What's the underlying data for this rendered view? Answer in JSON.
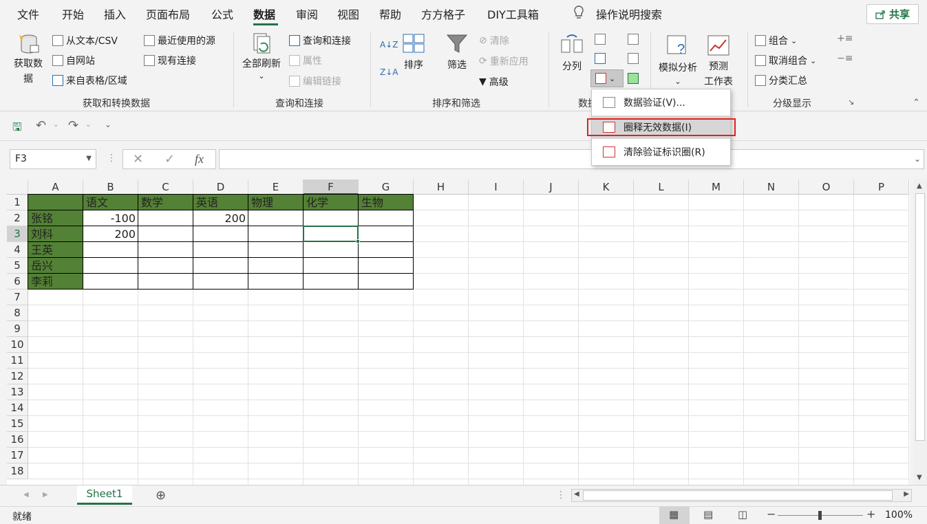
{
  "ribbon_tabs": [
    "文件",
    "开始",
    "插入",
    "页面布局",
    "公式",
    "数据",
    "审阅",
    "视图",
    "帮助",
    "方方格子",
    "DIY工具箱"
  ],
  "active_tab": "数据",
  "search_label": "操作说明搜索",
  "share_label": "共享",
  "groups": {
    "get_transform": {
      "label": "获取和转换数据",
      "get_data_1": "获取数",
      "get_data_2": "据",
      "from_text": "从文本/CSV",
      "from_web": "自网站",
      "from_table": "来自表格/区域",
      "recent_sources": "最近使用的源",
      "existing_conn": "现有连接"
    },
    "queries": {
      "label": "查询和连接",
      "refresh_all": "全部刷新",
      "queries_conn": "查询和连接",
      "properties": "属性",
      "edit_links": "编辑链接"
    },
    "sort_filter": {
      "label": "排序和筛选",
      "sort": "排序",
      "filter": "筛选",
      "clear": "清除",
      "reapply": "重新应用",
      "advanced": "高级"
    },
    "data_tools": {
      "label": "数据",
      "text_to_columns": "分列"
    },
    "forecast": {
      "what_if": "模拟分析",
      "forecast_sheet_1": "预测",
      "forecast_sheet_2": "工作表"
    },
    "outline": {
      "label": "分级显示",
      "group": "组合",
      "ungroup": "取消组合",
      "subtotal": "分类汇总"
    }
  },
  "dropdown": {
    "items": [
      "数据验证(V)...",
      "圈释无效数据(I)",
      "清除验证标识圈(R)"
    ],
    "highlighted_index": 1
  },
  "namebox_value": "F3",
  "formula_value": "",
  "columns": [
    "A",
    "B",
    "C",
    "D",
    "E",
    "F",
    "G",
    "H",
    "I",
    "J",
    "K",
    "L",
    "M",
    "N",
    "O",
    "P"
  ],
  "rows": [
    "1",
    "2",
    "3",
    "4",
    "5",
    "6",
    "7",
    "8",
    "9",
    "10",
    "11",
    "12",
    "13",
    "14",
    "15",
    "16",
    "17",
    "18"
  ],
  "cells": {
    "B1": "语文",
    "C1": "数学",
    "D1": "英语",
    "E1": "物理",
    "F1": "化学",
    "G1": "生物",
    "A2": "张铭",
    "A3": "刘科",
    "A4": "王英",
    "A5": "岳兴",
    "A6": "李莉",
    "B2": "-100",
    "D2": "200",
    "B3": "200"
  },
  "selected_cell": "F3",
  "sheet_tab": "Sheet1",
  "status_text": "就绪",
  "zoom": "100%",
  "colors": {
    "header_fill": "#538135",
    "accent": "#217346",
    "highlight_border": "#e02020"
  }
}
